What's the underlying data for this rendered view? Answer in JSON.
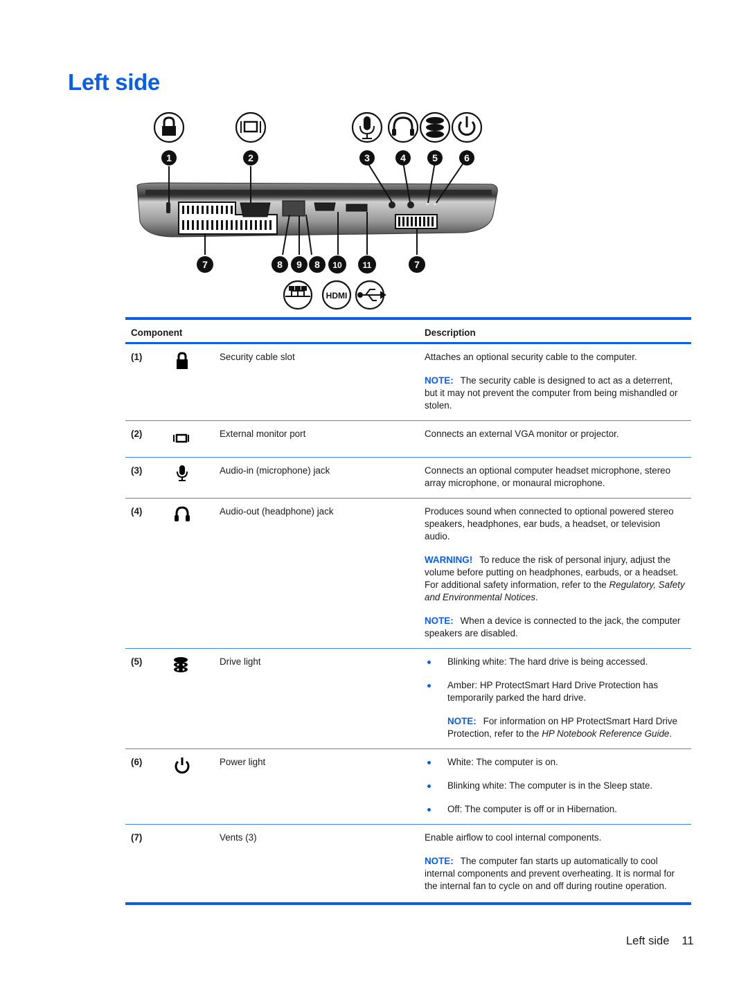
{
  "page": {
    "title": "Left side",
    "accent_color": "#0a5fe8",
    "footer": {
      "section": "Left side",
      "page_number": "11"
    }
  },
  "figure": {
    "top_icons": [
      "lock-icon",
      "monitor-icon",
      "microphone-icon",
      "headphone-icon",
      "drive-icon",
      "power-icon"
    ],
    "top_callouts": [
      "1",
      "2",
      "3",
      "4",
      "5",
      "6"
    ],
    "bottom_callouts": [
      "7",
      "8",
      "9",
      "8",
      "10",
      "11",
      "7"
    ],
    "bottom_icons": [
      "network-icon",
      "hdmi-icon",
      "usb-icon"
    ],
    "hdmi_label": "HDMI"
  },
  "table": {
    "headers": {
      "component": "Component",
      "description": "Description"
    },
    "rows": [
      {
        "num": "(1)",
        "icon": "lock-icon",
        "name": "Security cable slot",
        "desc": "Attaches an optional security cable to the computer.",
        "note_tag": "NOTE:",
        "note": "The security cable is designed to act as a deterrent, but it may not prevent the computer from being mishandled or stolen."
      },
      {
        "num": "(2)",
        "icon": "monitor-icon",
        "name": "External monitor port",
        "desc": "Connects an external VGA monitor or projector."
      },
      {
        "num": "(3)",
        "icon": "microphone-icon",
        "name": "Audio-in (microphone) jack",
        "desc": "Connects an optional computer headset microphone, stereo array microphone, or monaural microphone."
      },
      {
        "num": "(4)",
        "icon": "headphone-icon",
        "name": "Audio-out (headphone) jack",
        "desc": "Produces sound when connected to optional powered stereo speakers, headphones, ear buds, a headset, or television audio.",
        "warning_tag": "WARNING!",
        "warning": "To reduce the risk of personal injury, adjust the volume before putting on headphones, earbuds, or a headset. For additional safety information, refer to the",
        "warning_ref": "Regulatory, Safety and Environmental Notices",
        "note_tag": "NOTE:",
        "note": "When a device is connected to the jack, the computer speakers are disabled."
      },
      {
        "num": "(5)",
        "icon": "drive-icon",
        "name": "Drive light",
        "bullets": [
          "Blinking white: The hard drive is being accessed.",
          "Amber: HP ProtectSmart Hard Drive Protection has temporarily parked the hard drive."
        ],
        "note_tag": "NOTE:",
        "note": "For information on HP ProtectSmart Hard Drive Protection, refer to the",
        "note_ref": "HP Notebook Reference Guide"
      },
      {
        "num": "(6)",
        "icon": "power-icon",
        "name": "Power light",
        "bullets": [
          "White: The computer is on.",
          "Blinking white: The computer is in the Sleep state.",
          "Off: The computer is off or in Hibernation."
        ]
      },
      {
        "num": "(7)",
        "name": "Vents (3)",
        "desc": "Enable airflow to cool internal components.",
        "note_tag": "NOTE:",
        "note": "The computer fan starts up automatically to cool internal components and prevent overheating. It is normal for the internal fan to cycle on and off during routine operation."
      }
    ]
  }
}
